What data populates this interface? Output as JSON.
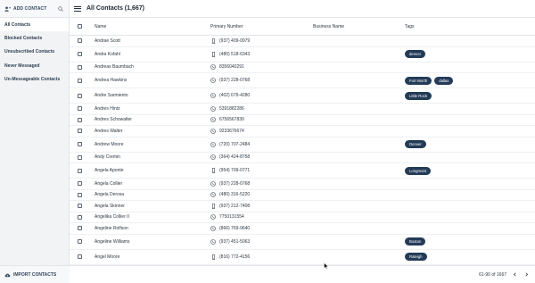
{
  "sidebar": {
    "add_contact_label": "ADD CONTACT",
    "items": [
      {
        "label": "All Contacts",
        "active": true
      },
      {
        "label": "Blocked Contacts",
        "active": false
      },
      {
        "label": "Unsubscribed Contacts",
        "active": false
      },
      {
        "label": "Never Messaged",
        "active": false
      },
      {
        "label": "Un-Messageable Contacts",
        "active": false
      }
    ],
    "import_label": "IMPORT CONTACTS"
  },
  "header": {
    "title": "All Contacts (1,667)"
  },
  "table": {
    "columns": [
      "Name",
      "Primary Number",
      "Business Name",
      "Tags"
    ],
    "rows": [
      {
        "name": "Andrae Scott",
        "phone": "(937) 409-0979",
        "phone_type": "mobile",
        "tags": []
      },
      {
        "name": "Andra Kofahl",
        "phone": "(480) 518-6343",
        "phone_type": "mobile",
        "tags": [
          "denver"
        ]
      },
      {
        "name": "Andreas Baumbach",
        "phone": "8356040291",
        "phone_type": "landline",
        "tags": []
      },
      {
        "name": "Andrea Hawkins",
        "phone": "(937) 228-0768",
        "phone_type": "landline",
        "tags": [
          "Fort Worth",
          "dallas"
        ]
      },
      {
        "name": "Andre Sarmiento",
        "phone": "(402) 679-4280",
        "phone_type": "landline",
        "tags": [
          "Little Rock"
        ]
      },
      {
        "name": "Andres Hintz",
        "phone": "5391882286",
        "phone_type": "landline",
        "tags": []
      },
      {
        "name": "Andres Schowalter",
        "phone": "6756567830",
        "phone_type": "landline",
        "tags": []
      },
      {
        "name": "Andres Walter",
        "phone": "9233676674",
        "phone_type": "landline",
        "tags": []
      },
      {
        "name": "Andrew Moore",
        "phone": "(720) 707-2484",
        "phone_type": "landline",
        "tags": [
          "Denver"
        ]
      },
      {
        "name": "Andy Cremin",
        "phone": "(364) 424-8758",
        "phone_type": "landline",
        "tags": []
      },
      {
        "name": "Angela Aponte",
        "phone": "(954) 709-0771",
        "phone_type": "mobile",
        "tags": [
          "Longmont"
        ]
      },
      {
        "name": "Angela Collier",
        "phone": "(937) 228-0768",
        "phone_type": "landline",
        "tags": []
      },
      {
        "name": "Angela Derosa",
        "phone": "(480) 316-5220",
        "phone_type": "landline",
        "tags": []
      },
      {
        "name": "Angela Skinner",
        "phone": "(937) 212-7408",
        "phone_type": "mobile",
        "tags": []
      },
      {
        "name": "Angelika Collier II",
        "phone": "7750131554",
        "phone_type": "landline",
        "tags": []
      },
      {
        "name": "Angeline Rolfson",
        "phone": "(866) 769-9640",
        "phone_type": "landline",
        "tags": []
      },
      {
        "name": "Angeline Williams",
        "phone": "(937) 451-5063",
        "phone_type": "landline",
        "tags": [
          "Boston"
        ]
      },
      {
        "name": "Angel Moore",
        "phone": "(816) 772-4156",
        "phone_type": "mobile",
        "tags": [
          "Raleigh"
        ]
      }
    ]
  },
  "pagination": {
    "range_text": "61-90 of 1667"
  },
  "colors": {
    "tag_bg": "#233b57",
    "sidebar_bg": "#f2f3f5",
    "active_item_bg": "#ffffff"
  }
}
